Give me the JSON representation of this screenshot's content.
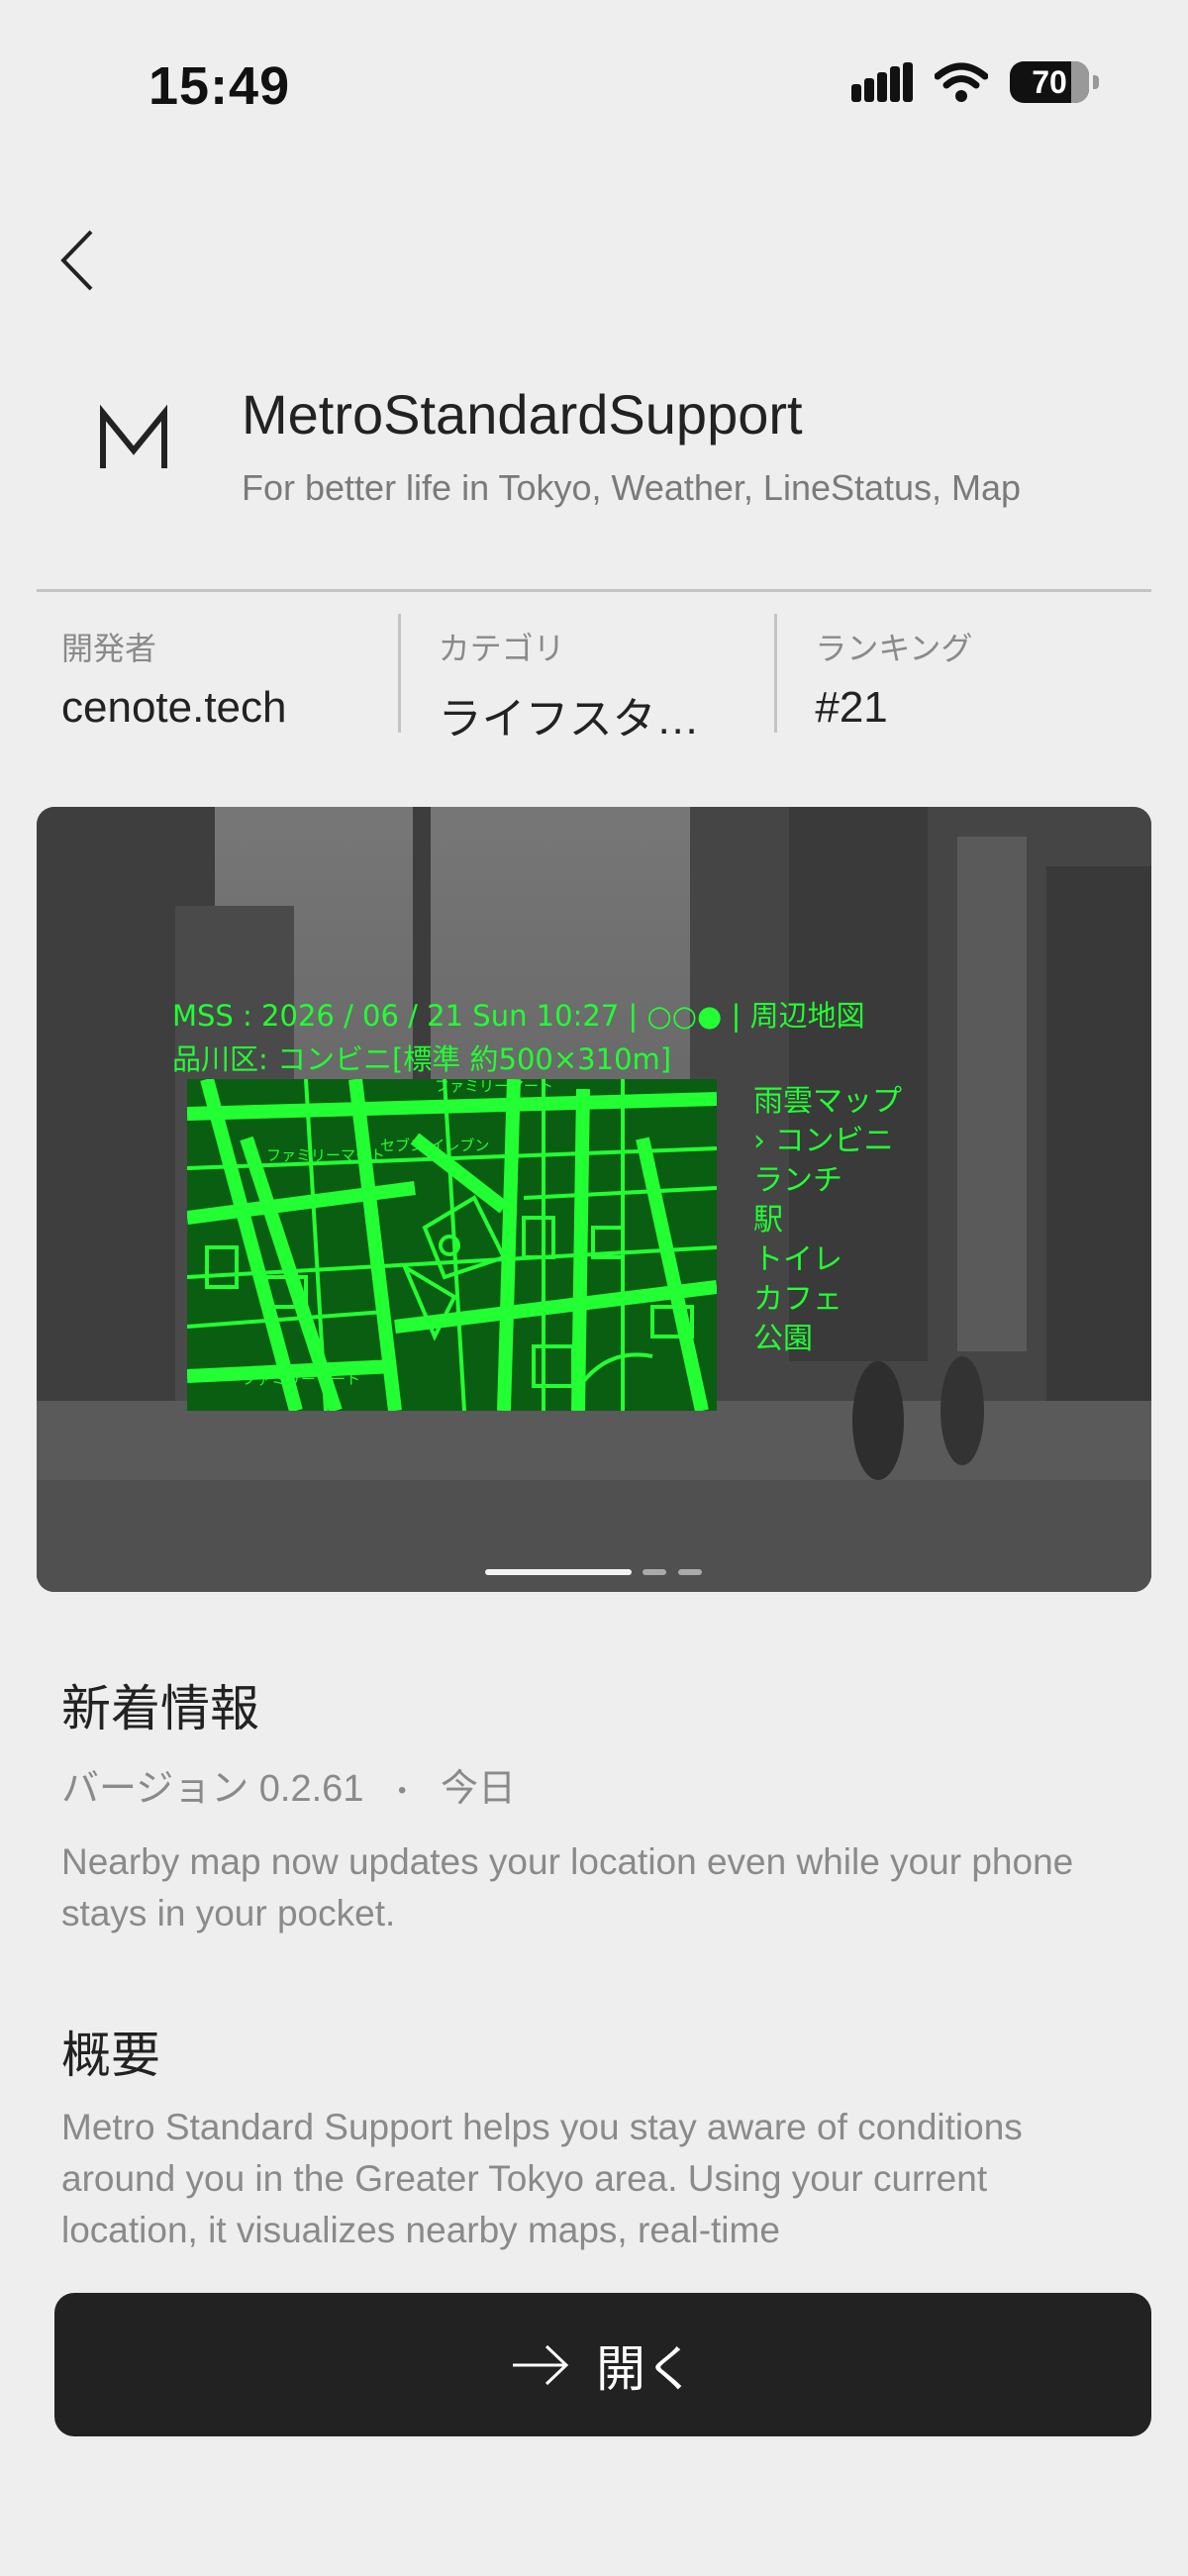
{
  "status_bar": {
    "time": "15:49",
    "battery": "70"
  },
  "app": {
    "name": "MetroStandardSupport",
    "tagline": "For better life in Tokyo, Weather, LineStatus, Map"
  },
  "info": [
    {
      "label": "開発者",
      "value": "cenote.tech"
    },
    {
      "label": "カテゴリ",
      "value": "ライフスタ…"
    },
    {
      "label": "ランキング",
      "value": "#21"
    }
  ],
  "screenshot": {
    "header_line1": "MSS : 2026 / 06 / 21  Sun  10:27 | ○○● | 周辺地図",
    "header_line2": "品川区:  コンビニ[標準 約500×310m]",
    "map_labels": [
      "ファミリーマート",
      "ファミリーマート",
      "セブン-イレブン",
      "ファミリーマート"
    ],
    "menu": [
      "雨雲マップ",
      "› コンビニ",
      "ランチ",
      "駅",
      "トイレ",
      "カフェ",
      "公園"
    ],
    "pager": {
      "count": 3,
      "active": 0
    }
  },
  "whats_new": {
    "title": "新着情報",
    "version": "バージョン 0.2.61",
    "separator": "•",
    "date": "今日",
    "notes": "Nearby map now updates your location even while your phone stays in your pocket."
  },
  "overview": {
    "title": "概要",
    "text": "Metro Standard Support helps you stay aware of conditions around you in the Greater Tokyo area. Using your current location, it visualizes nearby maps, real-time"
  },
  "open_button": {
    "label": "開く"
  },
  "colors": {
    "hud_green": "#22ff33",
    "button_bg": "#222222",
    "background": "#eeeeee"
  }
}
